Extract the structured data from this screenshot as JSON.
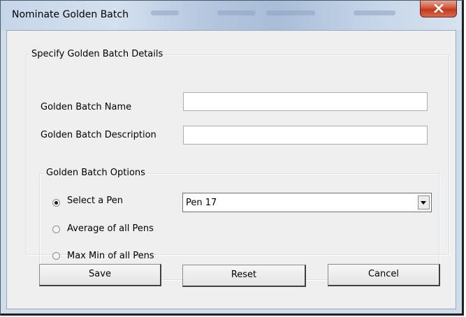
{
  "window": {
    "title": "Nominate Golden Batch"
  },
  "details_group": {
    "legend": "Specify Golden Batch Details",
    "name_label": "Golden Batch Name",
    "name_value": "",
    "description_label": "Golden Batch Description",
    "description_value": ""
  },
  "options_group": {
    "legend": "Golden Batch Options",
    "radios": [
      {
        "label": "Select a Pen",
        "checked": true
      },
      {
        "label": "Average of all Pens",
        "checked": false
      },
      {
        "label": "Max Min of all Pens",
        "checked": false
      }
    ],
    "pen_select_value": "Pen 17"
  },
  "buttons": {
    "save": "Save",
    "reset": "Reset",
    "cancel": "Cancel"
  },
  "colors": {
    "titlebar": "#c6d6e9",
    "close_button": "#c13a1f",
    "client_bg": "#efefef"
  }
}
